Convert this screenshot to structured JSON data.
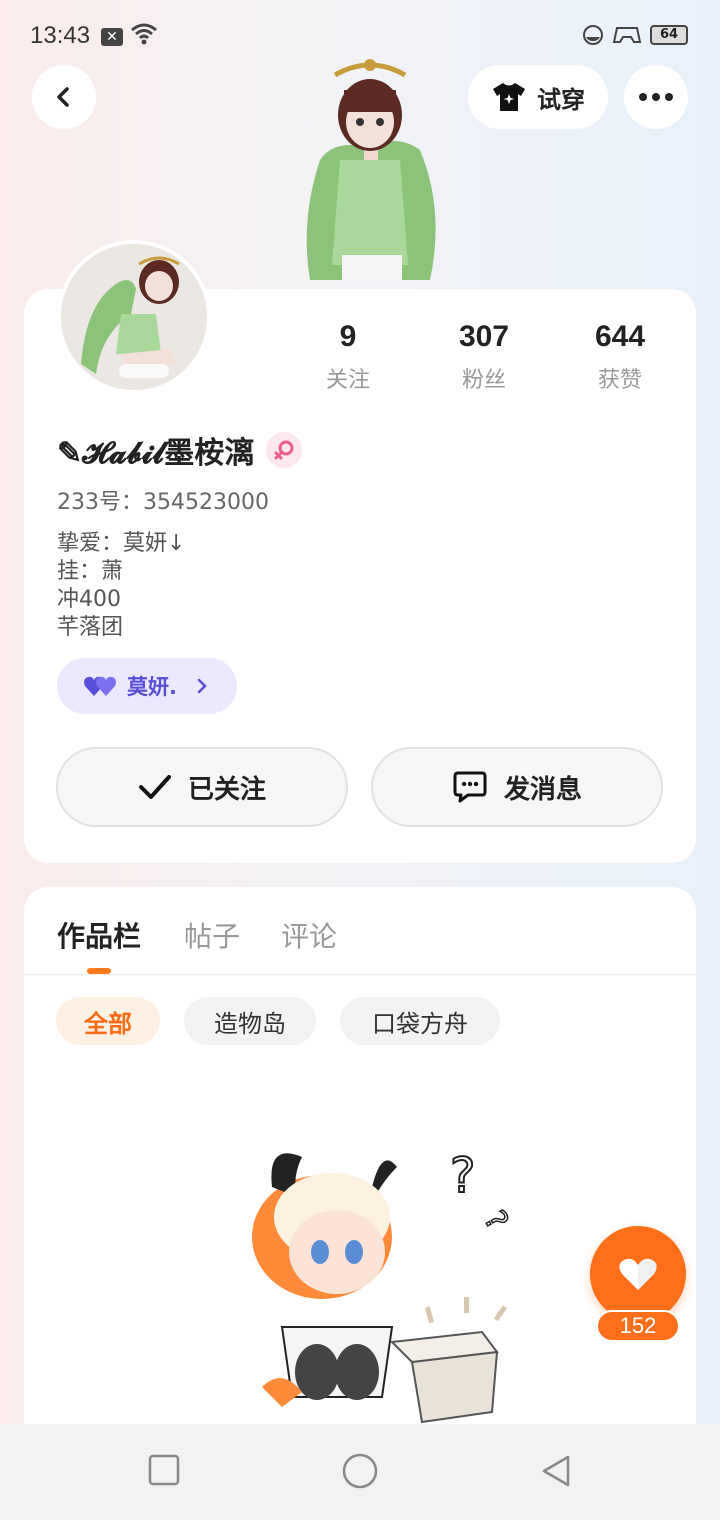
{
  "status_bar": {
    "time": "13:43",
    "notif_icon": "x-box-icon",
    "battery": "64"
  },
  "header": {
    "tryon_label": "试穿"
  },
  "profile": {
    "stats": [
      {
        "value": "9",
        "label": "关注"
      },
      {
        "value": "307",
        "label": "粉丝"
      },
      {
        "value": "644",
        "label": "获赞"
      }
    ],
    "username": "✎𝓗𝓪𝓫𝓲𝓵墨桉漓",
    "uid": "233号：354523000",
    "bio_lines": [
      "挚爱：莫妍↓",
      "挂：萧",
      "冲400",
      "芊落团"
    ],
    "relation_label": "莫妍.",
    "follow_label": "已关注",
    "message_label": "发消息"
  },
  "works": {
    "tabs": [
      "作品栏",
      "帖子",
      "评论"
    ],
    "chips": [
      "全部",
      "造物岛",
      "口袋方舟"
    ]
  },
  "like": {
    "count": "152"
  },
  "colors": {
    "accent": "#ff6f1a",
    "relation": "#5a4fd8"
  }
}
